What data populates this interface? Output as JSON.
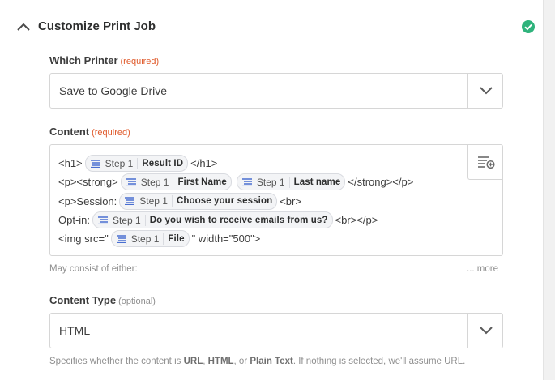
{
  "section": {
    "title": "Customize Print Job",
    "status_icon": "check-circle-icon",
    "status_color": "#2fb37c"
  },
  "printer_field": {
    "label": "Which Printer",
    "tag": "(required)",
    "value": "Save to Google Drive"
  },
  "content_field": {
    "label": "Content",
    "tag": "(required)",
    "lines": [
      {
        "before": "<h1>",
        "pills": [
          {
            "step": "Step 1",
            "field": "Result ID",
            "after": "</h1>"
          }
        ]
      },
      {
        "before": "<p><strong>",
        "pills": [
          {
            "step": "Step 1",
            "field": "First Name",
            "after": ""
          },
          {
            "step": "Step 1",
            "field": "Last name",
            "after": "</strong></p>"
          }
        ]
      },
      {
        "before": "<p>Session:",
        "pills": [
          {
            "step": "Step 1",
            "field": "Choose your session",
            "after": "<br>"
          }
        ]
      },
      {
        "before": "Opt-in:",
        "pills": [
          {
            "step": "Step 1",
            "field": "Do you wish to receive emails from us?",
            "after": "<br></p>"
          }
        ]
      },
      {
        "before": "<img src=\"",
        "pills": [
          {
            "step": "Step 1",
            "field": "File",
            "after": "\" width=\"500\">"
          }
        ]
      }
    ],
    "help": "May consist of either:",
    "more": "... more"
  },
  "content_type_field": {
    "label": "Content Type",
    "tag": "(optional)",
    "value": "HTML",
    "help_parts": {
      "p1": "Specifies whether the content is ",
      "url": "URL",
      "p2": ", ",
      "html": "HTML",
      "p3": ", or ",
      "plain": "Plain Text",
      "p4": ". If nothing is selected, we'll assume URL."
    }
  }
}
